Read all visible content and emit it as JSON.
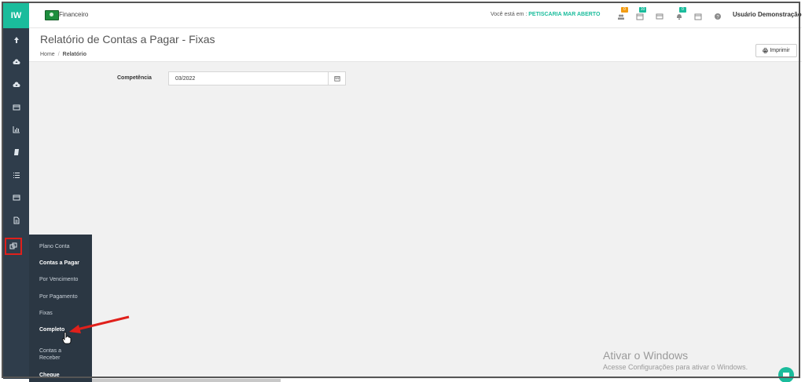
{
  "app": {
    "brand": "IW",
    "module": "Financeiro"
  },
  "topbar": {
    "location_prefix": "Você está em :",
    "location_place": "PETISCARIA MAR ABERTO",
    "badges": [
      {
        "icon": "users-icon",
        "count": "0",
        "color": "#f39c12"
      },
      {
        "icon": "calendar-icon",
        "count": "10",
        "color": "#1abc9c"
      },
      {
        "icon": "card-icon",
        "count": ""
      },
      {
        "icon": "bell-icon",
        "count": "0",
        "color": "#1abc9c"
      },
      {
        "icon": "calendar-icon",
        "count": ""
      },
      {
        "icon": "help-icon",
        "count": ""
      }
    ],
    "user": "Usuário Demonstração"
  },
  "page": {
    "title": "Relatório de Contas a Pagar - Fixas",
    "breadcrumb": [
      "Home",
      "Relatório"
    ],
    "print_label": "Imprimir"
  },
  "form": {
    "competencia_label": "Competência",
    "competencia_value": "03/2022"
  },
  "sidebar_icons": [
    "upload-icon",
    "cloud-upload-icon",
    "cloud-download-icon",
    "card-icon",
    "bar-chart-icon",
    "book-icon",
    "list-icon",
    "card-icon",
    "document-icon",
    "copy-icon"
  ],
  "submenu": [
    {
      "label": "Plano Conta",
      "bold": false
    },
    {
      "label": "Contas a Pagar",
      "bold": true
    },
    {
      "label": "Por Vencimento",
      "bold": false
    },
    {
      "label": "Por Pagamento",
      "bold": false
    },
    {
      "label": "Fixas",
      "bold": false
    },
    {
      "label": "Completo",
      "bold": true
    },
    {
      "label": "Contas a",
      "bold": false
    },
    {
      "label": "Receber",
      "bold": false
    },
    {
      "label": "Cheque",
      "bold": true
    }
  ],
  "watermark": {
    "title": "Ativar o Windows",
    "subtitle": "Acesse Configurações para ativar o Windows."
  },
  "colors": {
    "accent": "#1abc9c",
    "sidebar": "#2f3d4b",
    "annotation": "#e0201b"
  }
}
